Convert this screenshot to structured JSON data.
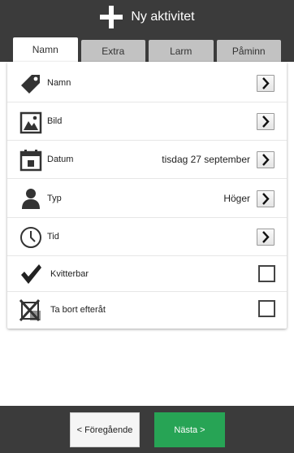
{
  "header": {
    "title": "Ny aktivitet"
  },
  "tabs": [
    {
      "label": "Namn",
      "active": true
    },
    {
      "label": "Extra",
      "active": false
    },
    {
      "label": "Larm",
      "active": false
    },
    {
      "label": "Påminn",
      "active": false
    }
  ],
  "rows": [
    {
      "label": "Namn",
      "value": "",
      "icon": "tag-icon",
      "control": "chevron"
    },
    {
      "label": "Bild",
      "value": "",
      "icon": "image-icon",
      "control": "chevron"
    },
    {
      "label": "Datum",
      "value": "tisdag 27 september",
      "icon": "calendar-icon",
      "control": "chevron"
    },
    {
      "label": "Typ",
      "value": "Höger",
      "icon": "person-icon",
      "control": "chevron"
    },
    {
      "label": "Tid",
      "value": "",
      "icon": "clock-icon",
      "control": "chevron"
    },
    {
      "label": "Kvitterbar",
      "value": "",
      "icon": "checkmark-icon",
      "control": "checkbox",
      "checked": false
    },
    {
      "label": "Ta bort efteråt",
      "value": "",
      "icon": "delete-box-icon",
      "control": "checkbox",
      "checked": false
    }
  ],
  "footer": {
    "prev_label": "< Föregående",
    "next_label": "Nästa >"
  },
  "colors": {
    "header_bg": "#3b3b3b",
    "next_button": "#27a455",
    "tab_inactive": "#c2c2c2"
  }
}
